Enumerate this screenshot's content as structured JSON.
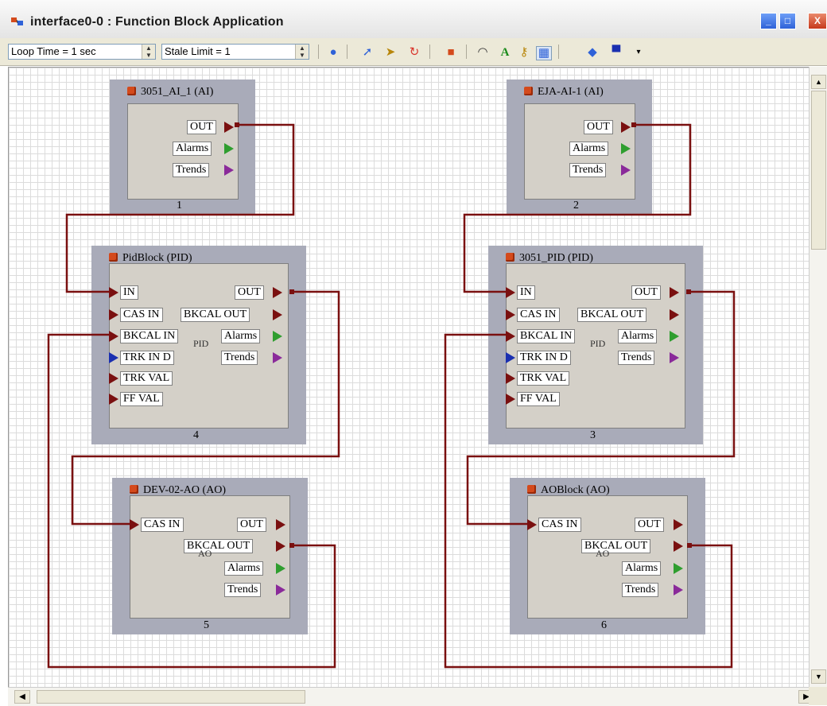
{
  "window": {
    "title": "interface0-0 : Function Block Application",
    "minimize_label": "_",
    "maximize_label": "□",
    "close_label": "X"
  },
  "toolbar": {
    "loop_time": "Loop Time = 1 sec",
    "stale_limit": "Stale Limit = 1",
    "icons": [
      "check-circle-icon",
      "pointer-icon",
      "connect-arrow-icon",
      "refresh-icon",
      "add-block-icon",
      "eye-icon",
      "text-icon",
      "key-icon",
      "calculator-icon",
      "fill-icon",
      "color-icon",
      "dropdown-arrow-icon"
    ]
  },
  "blocks": {
    "b1": {
      "title": "3051_AI_1 (AI)",
      "number": "1",
      "out": "OUT",
      "alarms": "Alarms",
      "trends": "Trends"
    },
    "b2": {
      "title": "EJA-AI-1 (AI)",
      "number": "2",
      "out": "OUT",
      "alarms": "Alarms",
      "trends": "Trends"
    },
    "b4": {
      "title": "PidBlock (PID)",
      "number": "4",
      "in": "IN",
      "cas_in": "CAS IN",
      "bkcal_in": "BKCAL IN",
      "trk_in_d": "TRK IN D",
      "trk_val": "TRK VAL",
      "ff_val": "FF VAL",
      "out": "OUT",
      "bkcal_out": "BKCAL OUT",
      "alarms": "Alarms",
      "trends": "Trends",
      "ghost": "PID"
    },
    "b3": {
      "title": "3051_PID (PID)",
      "number": "3",
      "in": "IN",
      "cas_in": "CAS IN",
      "bkcal_in": "BKCAL IN",
      "trk_in_d": "TRK IN D",
      "trk_val": "TRK VAL",
      "ff_val": "FF VAL",
      "out": "OUT",
      "bkcal_out": "BKCAL OUT",
      "alarms": "Alarms",
      "trends": "Trends",
      "ghost": "PID"
    },
    "b5": {
      "title": "DEV-02-AO (AO)",
      "number": "5",
      "cas_in": "CAS IN",
      "out": "OUT",
      "bkcal_out": "BKCAL OUT",
      "alarms": "Alarms",
      "trends": "Trends",
      "ghost": "AO"
    },
    "b6": {
      "title": "AOBlock (AO)",
      "number": "6",
      "cas_in": "CAS IN",
      "out": "OUT",
      "bkcal_out": "BKCAL OUT",
      "alarms": "Alarms",
      "trends": "Trends",
      "ghost": "AO"
    }
  },
  "colors": {
    "wire": "#7a1010",
    "block_frame": "#a9abb9",
    "block_body": "#d4d0c8",
    "port_output": "#7a1010",
    "port_alarms": "#2f9e2f",
    "port_trends": "#8a2a9a",
    "port_trk_in": "#1a2fb0"
  }
}
